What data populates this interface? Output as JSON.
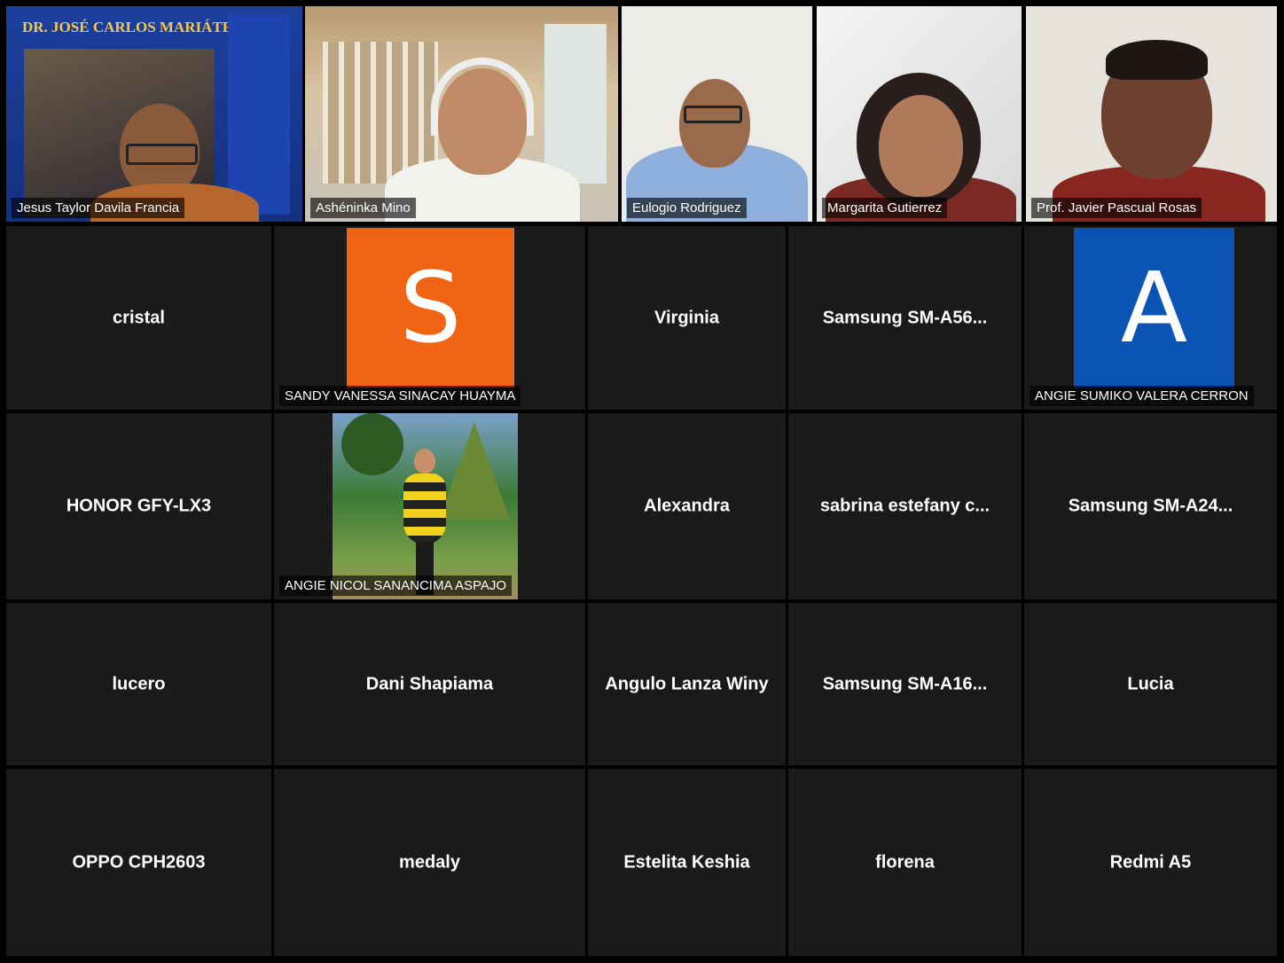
{
  "video_tiles": [
    {
      "name": "Jesus Taylor Davila Francia",
      "poster_title": "DR. JOSÉ CARLOS MARIÁTEGUI"
    },
    {
      "name": "Ashéninka Mino"
    },
    {
      "name": "Eulogio Rodriguez"
    },
    {
      "name": "Margarita Gutierrez"
    },
    {
      "name": "Prof. Javier Pascual Rosas"
    }
  ],
  "row2": [
    {
      "name": "cristal"
    },
    {
      "name": "SANDY VANESSA SINACAY HUAYMA",
      "initial": "S",
      "color": "#f06414"
    },
    {
      "name": "Virginia"
    },
    {
      "name": "Samsung  SM-A56..."
    },
    {
      "name": "ANGIE SUMIKO VALERA CERRON",
      "initial": "A",
      "color": "#0b54b5"
    }
  ],
  "row3": [
    {
      "name": "HONOR GFY-LX3"
    },
    {
      "name": "ANGIE NICOL SANANCIMA ASPAJO"
    },
    {
      "name": "Alexandra"
    },
    {
      "name": "sabrina  estefany c..."
    },
    {
      "name": "Samsung  SM-A24..."
    }
  ],
  "row4": [
    {
      "name": "lucero"
    },
    {
      "name": "Dani Shapiama"
    },
    {
      "name": "Angulo Lanza Winy"
    },
    {
      "name": "Samsung  SM-A16..."
    },
    {
      "name": "Lucia"
    }
  ],
  "row5": [
    {
      "name": "OPPO CPH2603"
    },
    {
      "name": "medaly"
    },
    {
      "name": "Estelita Keshia"
    },
    {
      "name": "florena"
    },
    {
      "name": "Redmi A5"
    }
  ]
}
